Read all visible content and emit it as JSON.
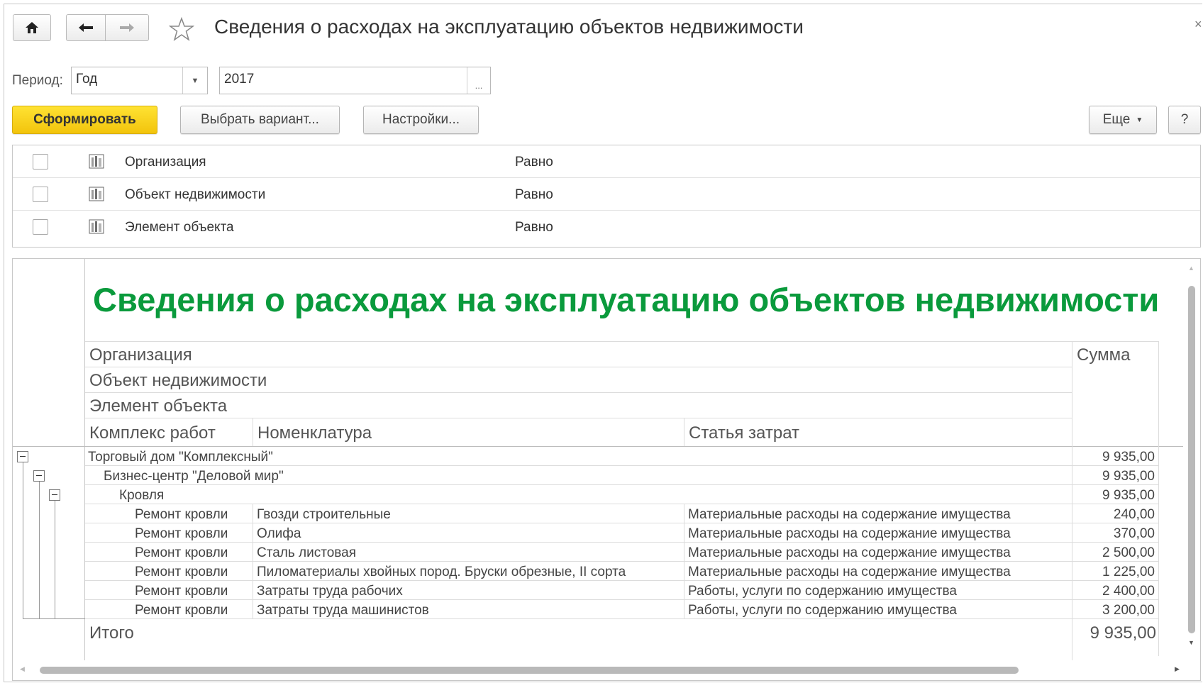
{
  "window": {
    "title": "Сведения о расходах на эксплуатацию объектов недвижимости",
    "close_glyph": "×"
  },
  "period": {
    "label": "Период:",
    "type_value": "Год",
    "year_value": "2017",
    "ellipsis": "..."
  },
  "toolbar": {
    "generate_label": "Сформировать",
    "choose_variant_label": "Выбрать вариант...",
    "settings_label": "Настройки...",
    "more_label": "Еще",
    "help_label": "?"
  },
  "filters": [
    {
      "name": "Организация",
      "condition": "Равно"
    },
    {
      "name": "Объект недвижимости",
      "condition": "Равно"
    },
    {
      "name": "Элемент объекта",
      "condition": "Равно"
    }
  ],
  "report": {
    "title": "Сведения о расходах на эксплуатацию объектов недвижимости",
    "headers": {
      "organization": "Организация",
      "object": "Объект недвижимости",
      "element": "Элемент объекта",
      "work_complex": "Комплекс работ",
      "nomenclature": "Номенклатура",
      "cost_item": "Статья затрат",
      "sum": "Сумма"
    },
    "groups": [
      {
        "label": "Торговый дом \"Комплексный\"",
        "sum": "9 935,00"
      },
      {
        "label": "Бизнес-центр \"Деловой мир\"",
        "sum": "9 935,00"
      },
      {
        "label": "Кровля",
        "sum": "9 935,00"
      }
    ],
    "rows": [
      {
        "work": "Ремонт кровли",
        "nomenclature": "Гвозди строительные",
        "cost_item": "Материальные расходы на содержание имущества",
        "sum": "240,00"
      },
      {
        "work": "Ремонт кровли",
        "nomenclature": "Олифа",
        "cost_item": "Материальные расходы на содержание имущества",
        "sum": "370,00"
      },
      {
        "work": "Ремонт кровли",
        "nomenclature": "Сталь листовая",
        "cost_item": "Материальные расходы на содержание имущества",
        "sum": "2 500,00"
      },
      {
        "work": "Ремонт кровли",
        "nomenclature": "Пиломатериалы хвойных пород. Бруски обрезные, II сорта",
        "cost_item": "Материальные расходы на содержание имущества",
        "sum": "1 225,00"
      },
      {
        "work": "Ремонт кровли",
        "nomenclature": "Затраты труда рабочих",
        "cost_item": "Работы, услуги по содержанию имущества",
        "sum": "2 400,00"
      },
      {
        "work": "Ремонт кровли",
        "nomenclature": "Затраты труда машинистов",
        "cost_item": "Работы, услуги по содержанию имущества",
        "sum": "3 200,00"
      }
    ],
    "total_label": "Итого",
    "total_sum": "9 935,00"
  },
  "colors": {
    "accent_button": "#f2c40c",
    "report_title": "#0a9a3c"
  }
}
